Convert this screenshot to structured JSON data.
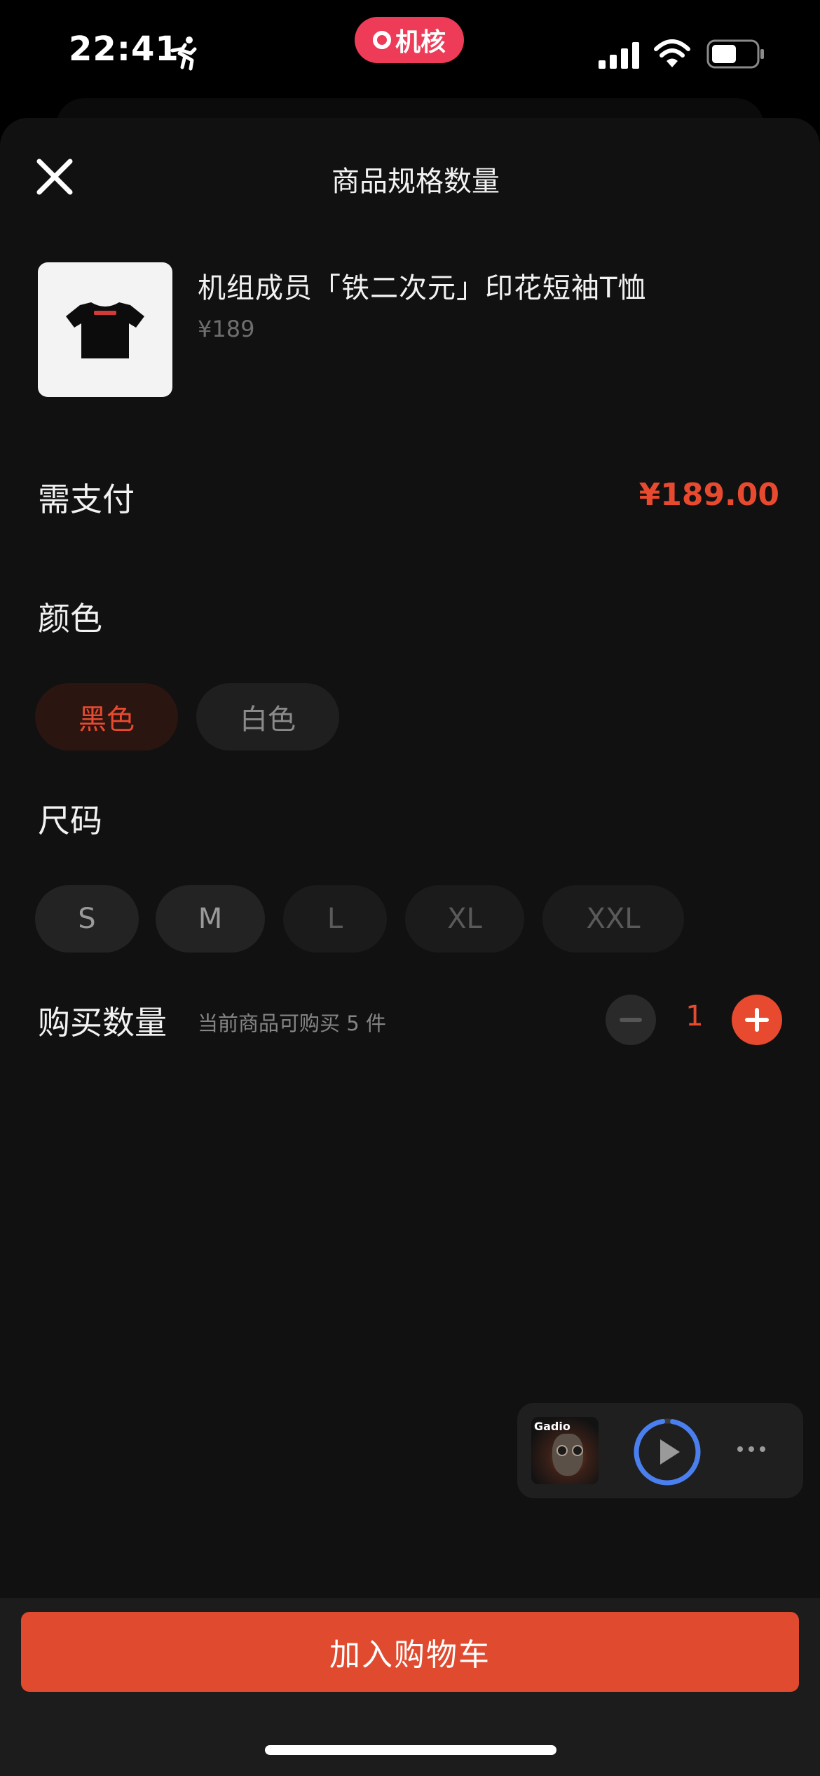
{
  "status_bar": {
    "time": "22:41",
    "activity_icon": "running-person-icon",
    "app_badge": "机核",
    "signal_icon": "cellular-signal-icon",
    "wifi_icon": "wifi-icon",
    "battery_icon": "battery-icon"
  },
  "sheet": {
    "title": "商品规格数量",
    "close_icon": "close-icon"
  },
  "product": {
    "name": "机组成员「铁二次元」印花短袖T恤",
    "price": "¥189",
    "thumbnail_icon": "tshirt-thumbnail"
  },
  "payment": {
    "label": "需支付",
    "amount": "¥189.00"
  },
  "color": {
    "label": "颜色",
    "options": [
      "黑色",
      "白色"
    ],
    "selected": "黑色"
  },
  "size": {
    "label": "尺码",
    "options": [
      "S",
      "M",
      "L",
      "XL",
      "XXL"
    ]
  },
  "quantity": {
    "label": "购买数量",
    "hint": "当前商品可购买 5 件",
    "value": "1",
    "minus_icon": "minus-icon",
    "plus_icon": "plus-icon"
  },
  "mini_player": {
    "cover_title": "Gadio",
    "play_icon": "play-icon",
    "more_icon": "more-icon"
  },
  "footer": {
    "add_to_cart": "加入购物车"
  },
  "colors": {
    "accent": "#e84a2f",
    "background": "#111111",
    "badge": "#ee3b58"
  }
}
